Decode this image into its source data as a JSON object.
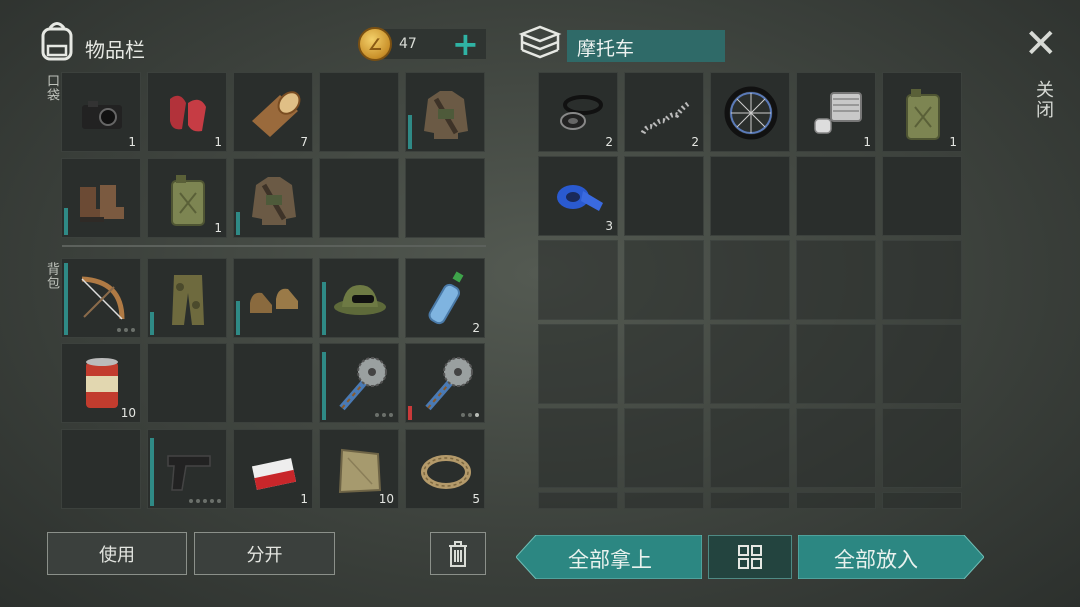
{
  "inventory": {
    "title": "物品栏",
    "coins": "47",
    "pocket_label": "口袋",
    "backpack_label": "背包",
    "pocket": [
      {
        "icon": "camera-icon",
        "count": "1"
      },
      {
        "icon": "red-cloth-icon",
        "count": "1"
      },
      {
        "icon": "log-icon",
        "count": "7"
      },
      {
        "icon": "empty",
        "count": ""
      },
      {
        "icon": "jacket-icon",
        "count": "",
        "durability": 0.45
      },
      {
        "icon": "boots-icon",
        "count": "",
        "durability": 0.35
      },
      {
        "icon": "jerrycan-icon",
        "count": "1"
      },
      {
        "icon": "jacket-icon",
        "count": "",
        "durability": 0.3
      },
      {
        "icon": "empty",
        "count": ""
      },
      {
        "icon": "empty",
        "count": ""
      }
    ],
    "backpack": [
      {
        "icon": "bow-icon",
        "count": "",
        "durability": 0.95,
        "dots": [
          0,
          0,
          0
        ]
      },
      {
        "icon": "camo-pants-icon",
        "count": "",
        "durability": 0.3
      },
      {
        "icon": "shoes-icon",
        "count": "",
        "durability": 0.45
      },
      {
        "icon": "camo-hat-icon",
        "count": "",
        "durability": 0.7
      },
      {
        "icon": "water-bottle-icon",
        "count": "2"
      },
      {
        "icon": "food-can-icon",
        "count": "10"
      },
      {
        "icon": "empty",
        "count": ""
      },
      {
        "icon": "empty",
        "count": ""
      },
      {
        "icon": "saw-mace-icon",
        "count": "",
        "durability": 0.9,
        "dots": [
          0,
          0,
          0
        ]
      },
      {
        "icon": "saw-mace-icon",
        "count": "",
        "durability": 0.18,
        "durability_color": "#c93a3a",
        "dots": [
          0,
          0,
          1
        ]
      },
      {
        "icon": "empty",
        "count": ""
      },
      {
        "icon": "pistol-icon",
        "count": "",
        "durability": 0.9,
        "dots": [
          0,
          0,
          0,
          0,
          0
        ]
      },
      {
        "icon": "cigarettes-icon",
        "count": "1"
      },
      {
        "icon": "sack-icon",
        "count": "10"
      },
      {
        "icon": "rope-icon",
        "count": "5"
      }
    ],
    "buttons": {
      "use": "使用",
      "split": "分开"
    }
  },
  "vehicle": {
    "name": "摩托车",
    "slots": [
      {
        "icon": "gasket-icon",
        "count": "2"
      },
      {
        "icon": "spring-icon",
        "count": "2"
      },
      {
        "icon": "wheel-icon",
        "count": ""
      },
      {
        "icon": "engine-piston-icon",
        "count": "1"
      },
      {
        "icon": "jerrycan-icon",
        "count": "1"
      },
      {
        "icon": "blue-tape-icon",
        "count": "3"
      }
    ],
    "take_all": "全部拿上",
    "put_all": "全部放入"
  },
  "close_label": "关闭",
  "colors": {
    "accent": "#2c8782",
    "durability": "#2f8a86",
    "warning": "#c93a3a",
    "coin": "#e0a93a"
  }
}
